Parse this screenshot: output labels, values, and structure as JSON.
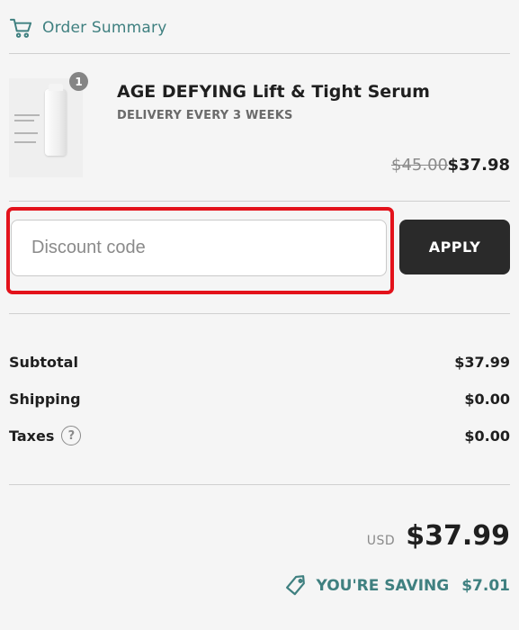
{
  "header": {
    "title": "Order Summary",
    "icon": "cart-icon"
  },
  "product": {
    "quantity": "1",
    "name": "AGE DEFYING Lift & Tight Serum",
    "delivery": "DELIVERY EVERY 3 WEEKS",
    "original_price": "$45.00",
    "price": "$37.98"
  },
  "discount": {
    "placeholder": "Discount code",
    "value": "",
    "apply_label": "APPLY"
  },
  "summary": {
    "subtotal_label": "Subtotal",
    "subtotal_value": "$37.99",
    "shipping_label": "Shipping",
    "shipping_value": "$0.00",
    "taxes_label": "Taxes",
    "taxes_value": "$0.00"
  },
  "total": {
    "currency": "USD",
    "amount": "$37.99"
  },
  "saving": {
    "label": "YOU'RE SAVING",
    "amount": "$7.01",
    "icon": "tag-icon"
  },
  "colors": {
    "accent": "#3f8080",
    "button": "#2a2a2a",
    "highlight": "#e3121b",
    "background": "#f5f5f5"
  }
}
